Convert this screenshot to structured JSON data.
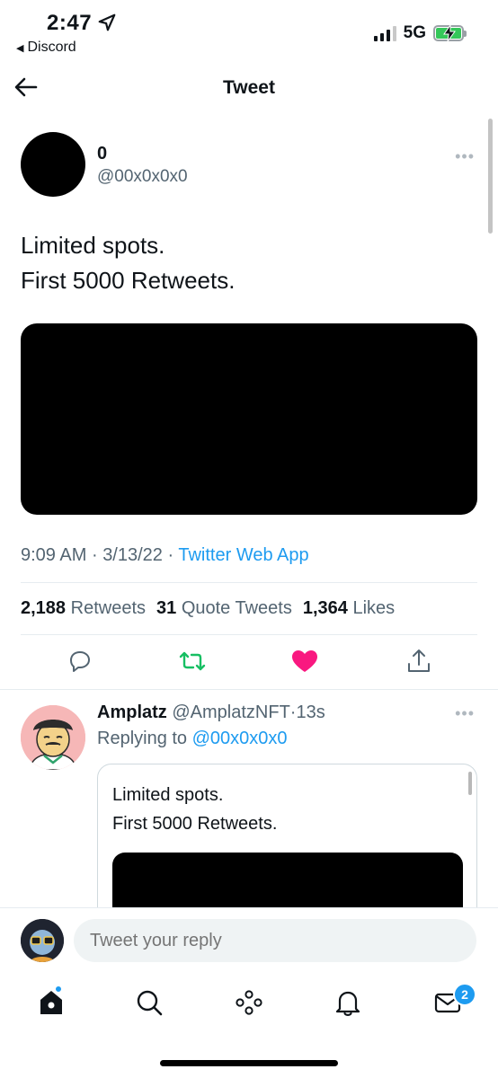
{
  "status_bar": {
    "time": "2:47",
    "back_app": "Discord",
    "network": "5G",
    "icons": [
      "location-arrow-icon",
      "signal-bars-icon",
      "battery-charging-icon"
    ]
  },
  "header": {
    "title": "Tweet",
    "back_icon": "back-arrow-icon"
  },
  "tweet": {
    "author_name": "0",
    "author_handle": "@00x0x0x0",
    "text_line1": "Limited spots.",
    "text_line2": "First 5000 Retweets.",
    "time": "9:09 AM",
    "date": "3/13/22",
    "source": "Twitter Web App",
    "sep": "·",
    "retweets_count": "2,188",
    "retweets_label": "Retweets",
    "quotes_count": "31",
    "quotes_label": "Quote Tweets",
    "likes_count": "1,364",
    "likes_label": "Likes",
    "more": "•••"
  },
  "actions": {
    "reply": "reply-bubble-icon",
    "retweet": "retweet-icon",
    "like": "heart-icon",
    "share": "share-icon",
    "colors": {
      "retweet": "#17bf63",
      "like": "#f91880",
      "neutral": "#536471"
    }
  },
  "reply": {
    "author_name": "Amplatz",
    "author_handle": "@AmplatzNFT",
    "time": "13s",
    "replying_prefix": "Replying to",
    "replying_handle": "@00x0x0x0",
    "quote_line1": "Limited spots.",
    "quote_line2": "First 5000 Retweets.",
    "more": "•••"
  },
  "composer": {
    "placeholder": "Tweet your reply"
  },
  "tabbar": {
    "items": [
      "home-icon",
      "search-icon",
      "spaces-icon",
      "notifications-icon",
      "messages-icon"
    ],
    "messages_badge": "2"
  },
  "colors": {
    "accent": "#1d9bf0",
    "text": "#0f1419",
    "muted": "#536471"
  }
}
